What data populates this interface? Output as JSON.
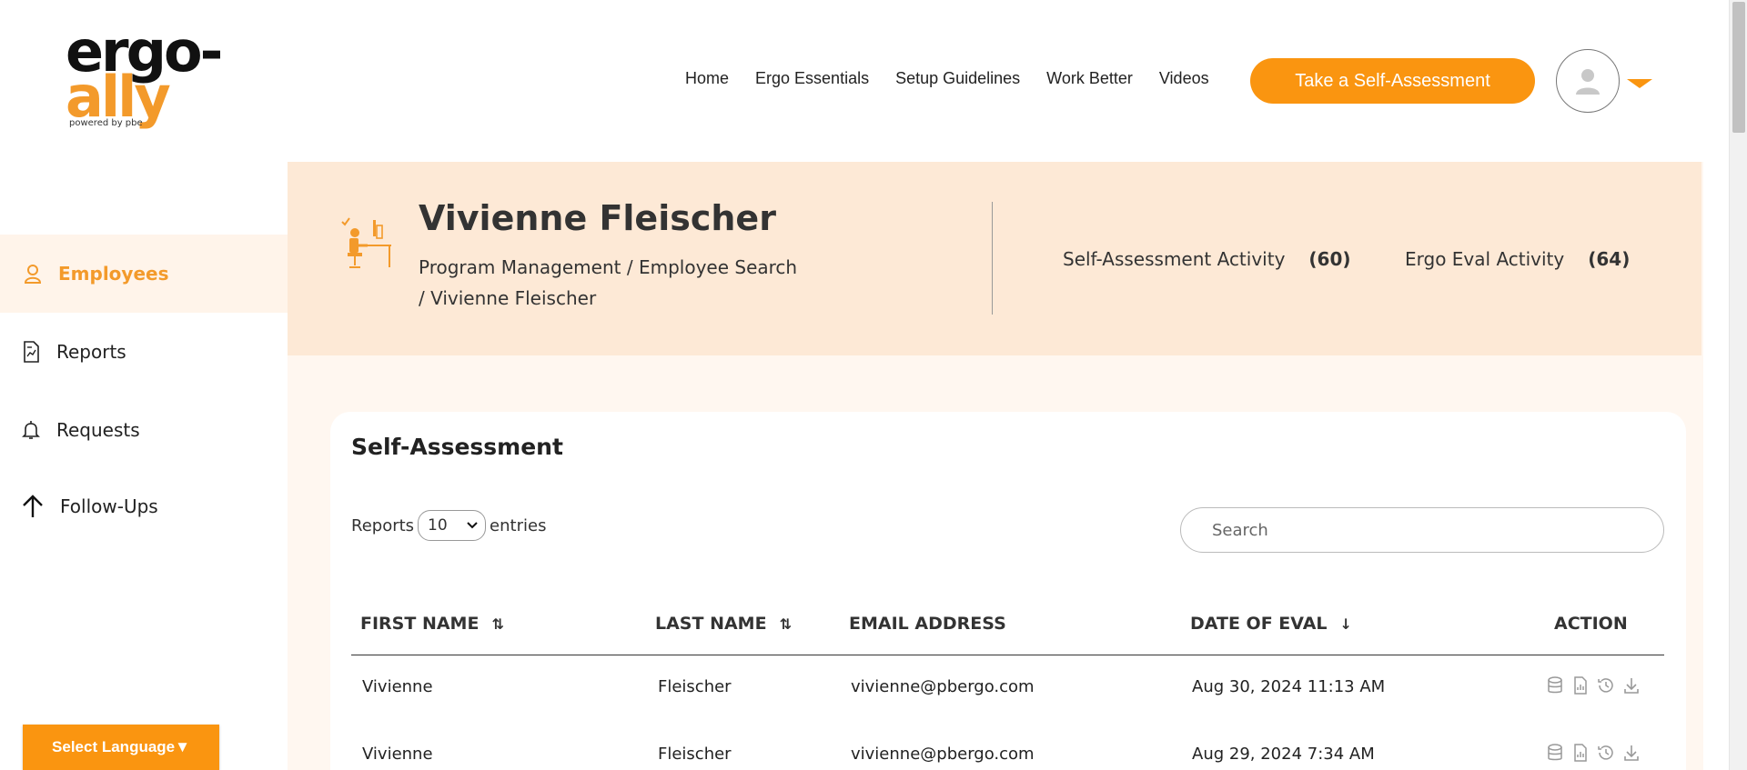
{
  "logo": {
    "line1": "ergo-",
    "line2": "ally",
    "tagline": "powered by pbe"
  },
  "nav": {
    "items": [
      "Home",
      "Ergo Essentials",
      "Setup Guidelines",
      "Work Better",
      "Videos"
    ],
    "cta_label": "Take a Self-Assessment"
  },
  "sidebar": {
    "items": [
      {
        "label": "Employees",
        "icon": "user-icon",
        "active": true
      },
      {
        "label": "Reports",
        "icon": "report-icon"
      },
      {
        "label": "Requests",
        "icon": "bell-icon"
      },
      {
        "label": "Follow-Ups",
        "icon": "arrow-up-icon"
      }
    ],
    "language_label": "Select Language▼"
  },
  "banner": {
    "name": "Vivienne Fleischer",
    "breadcrumb": [
      "Program Management",
      "Employee Search",
      "Vivienne Fleischer"
    ],
    "stats": [
      {
        "label": "Self-Assessment Activity",
        "count": "(60)"
      },
      {
        "label": "Ergo Eval Activity",
        "count": "(64)"
      }
    ]
  },
  "table": {
    "title": "Self-Assessment",
    "entries_prefix": "Reports",
    "entries_value": "10",
    "entries_suffix": "entries",
    "search_placeholder": "Search",
    "columns": [
      "FIRST NAME",
      "LAST NAME",
      "EMAIL ADDRESS",
      "DATE OF EVAL",
      "ACTION"
    ],
    "rows": [
      {
        "first": "Vivienne",
        "last": "Fleischer",
        "email": "vivienne@pbergo.com",
        "date": "Aug 30, 2024 11:13 AM"
      },
      {
        "first": "Vivienne",
        "last": "Fleischer",
        "email": "vivienne@pbergo.com",
        "date": "Aug 29, 2024 7:34 AM"
      }
    ]
  },
  "colors": {
    "accent": "#fa9510",
    "banner_bg": "#fde9d6",
    "sidebar_active_bg": "#fff4ea"
  }
}
